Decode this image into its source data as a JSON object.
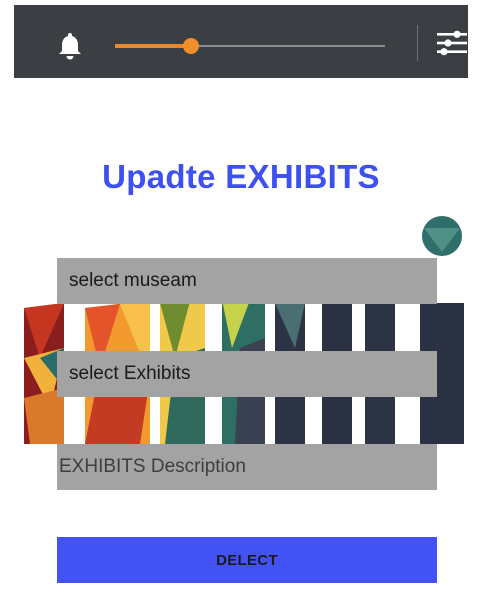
{
  "toolbar": {
    "bell_icon": "bell-icon",
    "filter_icon": "sliders-icon",
    "slider_value": 0.28,
    "accent_color": "#e88a2b",
    "background": "#3b3f44"
  },
  "page": {
    "title": "Upadte EXHIBITS",
    "title_color": "#3d50f2"
  },
  "form": {
    "museum_select": "select museam",
    "exhibits_select": "select Exhibits",
    "description_placeholder": "EXHIBITS Description",
    "submit_label": "DELECT",
    "button_color": "#4352f5"
  }
}
